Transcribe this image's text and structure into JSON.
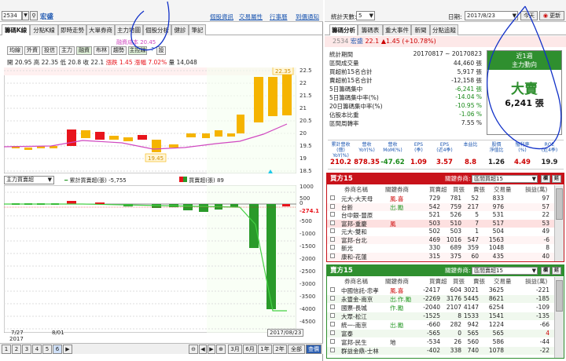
{
  "left_top": {
    "code": "2534",
    "name": "宏盛",
    "links": [
      "個股資訊",
      "交易屬性",
      "行事曆",
      "到價通知"
    ]
  },
  "left_tabs": [
    "籌碼K線",
    "分點K線",
    "即時走勢",
    "大單券商",
    "主力地圖",
    "個股分析",
    "健診",
    "筆記"
  ],
  "chart_note": "融資成本 20.45",
  "chart_buttons": [
    "均線",
    "外資",
    "投信",
    "主力",
    "融資",
    "布林",
    "趨勢",
    "主控線",
    "?",
    "設"
  ],
  "quote": {
    "open_label": "開",
    "open": "20.95",
    "high_label": "高",
    "high": "22.35",
    "low_label": "低",
    "low": "20.8",
    "close_label": "收",
    "close": "22.1",
    "chg_label": "漲跌",
    "chg": "1.45",
    "pct_label": "漲幅",
    "pct": "7.02%",
    "vol_label": "量",
    "vol": "14,048"
  },
  "k_axis": [
    "22.5",
    "22",
    "21.5",
    "21",
    "20.5",
    "20",
    "19.5",
    "19",
    "18.5"
  ],
  "price_tags": {
    "high": "22.35",
    "low": "19.45"
  },
  "lower_select": "主力買賣超",
  "lower_legend": {
    "cum_label": "累計買賣超(張)",
    "cum": "-5,755",
    "daily_label": "買賣超(張)",
    "daily": "89"
  },
  "lower_axis": [
    "1000",
    "500",
    "0",
    "-500",
    "-1000",
    "-1500",
    "-2000",
    "-2500",
    "-3000",
    "-3500",
    "-4000",
    "-4500"
  ],
  "lower_tag": "-274.1",
  "dates": {
    "d1": "7/27",
    "year": "2017",
    "d2": "8/01",
    "d3": "2017/08/23"
  },
  "pages": [
    "1",
    "2",
    "3",
    "4",
    "5",
    "6"
  ],
  "periods": [
    "3月",
    "6月",
    "1年",
    "2年",
    "全部"
  ],
  "query_btn": "查價",
  "right_top": {
    "days_label": "統計天數:",
    "days": "5",
    "date_label": "日期:",
    "date": "2017/8/23",
    "today": "今天",
    "refresh": "更新"
  },
  "right_tabs": [
    "籌碼分析",
    "籌碼表",
    "重大事件",
    "新聞",
    "分點追蹤"
  ],
  "stock_line": {
    "code": "2534",
    "name": "宏盛",
    "price": "22.1",
    "chg": "▲1.45",
    "pct": "(+10.78%)"
  },
  "stats": [
    {
      "label": "統計期間",
      "value": "20170817 ~ 20170823",
      "color": "#222"
    },
    {
      "label": "區間成交量",
      "value": "44,460 張",
      "color": "#222"
    },
    {
      "label": "買超前15名合計",
      "value": "5,917 張",
      "color": "#222"
    },
    {
      "label": "賣超前15名合計",
      "value": "-12,158 張",
      "color": "#222"
    },
    {
      "label": "5日籌碼集中",
      "value": "-6,241 張",
      "color": "#1a8a1a"
    },
    {
      "label": "5日籌碼集中率(%)",
      "value": "-14.04 %",
      "color": "#1a8a1a"
    },
    {
      "label": "20日籌碼集中率(%)",
      "value": "-10.95 %",
      "color": "#1a8a1a"
    },
    {
      "label": "佔股本比重",
      "value": "-1.06 %",
      "color": "#1a8a1a"
    },
    {
      "label": "區間周轉率",
      "value": "7.55 %",
      "color": "#222"
    }
  ],
  "signal": {
    "period": "近1週",
    "title": "主力動向",
    "verdict": "大賣",
    "amount": "6,241 張"
  },
  "metrics": [
    {
      "label": "累計營收(億)",
      "sub": "YoY(%)",
      "value": "210.2",
      "color": "#c00"
    },
    {
      "label": "營收",
      "sub": "YoY(%)",
      "value": "878.35",
      "color": "#c00"
    },
    {
      "label": "營收",
      "sub": "MoM(%)",
      "value": "-47.62",
      "color": "#1a8a1a"
    },
    {
      "label": "EPS",
      "sub": "(季)",
      "value": "1.09",
      "color": "#c00"
    },
    {
      "label": "EPS",
      "sub": "(近4季)",
      "value": "3.57",
      "color": "#c00"
    },
    {
      "label": "本益比",
      "sub": "",
      "value": "8.8",
      "color": "#c00"
    },
    {
      "label": "股價",
      "sub": "淨值比",
      "value": "1.26",
      "color": "#222"
    },
    {
      "label": "殖利率",
      "sub": "(%)",
      "value": "4.49",
      "color": "#c00"
    },
    {
      "label": "ROE",
      "sub": "(近4季)",
      "value": "19.9",
      "color": "#222"
    }
  ],
  "buy": {
    "title": "買方15",
    "filter_label": "關鍵券商:",
    "filter": "區間買超15",
    "cols": [
      "券商名稱",
      "關鍵券商",
      "買賣超",
      "買張",
      "賣張",
      "交易量",
      "損益(萬)"
    ],
    "rows": [
      [
        "元大-大天母",
        "風.喜",
        "729",
        "781",
        "52",
        "833",
        "97"
      ],
      [
        "台新",
        "出.勵",
        "542",
        "759",
        "217",
        "976",
        "57"
      ],
      [
        "台中銀-豐原",
        "",
        "521",
        "526",
        "5",
        "531",
        "22"
      ],
      [
        "富邦-重慶",
        "風",
        "503",
        "510",
        "7",
        "517",
        "53"
      ],
      [
        "元大-雙和",
        "",
        "502",
        "503",
        "1",
        "504",
        "49"
      ],
      [
        "富邦-台北",
        "",
        "469",
        "1016",
        "547",
        "1563",
        "-6"
      ],
      [
        "新光",
        "",
        "330",
        "689",
        "359",
        "1048",
        "8"
      ],
      [
        "康和-花蓮",
        "",
        "315",
        "375",
        "60",
        "435",
        "40"
      ]
    ]
  },
  "sell": {
    "title": "賣方15",
    "filter_label": "關鍵券商:",
    "filter": "區間賣超15",
    "cols": [
      "券商名稱",
      "關鍵券商",
      "買賣超",
      "買張",
      "賣張",
      "交易量",
      "損益(萬)"
    ],
    "rows": [
      [
        "中國信託-忠孝",
        "風.喜",
        "-2417",
        "604",
        "3021",
        "3625",
        "-221"
      ],
      [
        "永豐金-南京",
        "出.作.勵",
        "-2269",
        "3176",
        "5445",
        "8621",
        "-185"
      ],
      [
        "國票-長城",
        "作.勵",
        "-2040",
        "2107",
        "4147",
        "6254",
        "-109"
      ],
      [
        "大眾-松江",
        "",
        "-1525",
        "8",
        "1533",
        "1541",
        "-135"
      ],
      [
        "統一-南京",
        "出.勵",
        "-660",
        "282",
        "942",
        "1224",
        "-66"
      ],
      [
        "富泰",
        "",
        "-565",
        "0",
        "565",
        "565",
        "4"
      ],
      [
        "富邦-民生",
        "地",
        "-534",
        "26",
        "560",
        "586",
        "-44"
      ],
      [
        "群益金鼎-士林",
        "",
        "-402",
        "338",
        "740",
        "1078",
        "-22"
      ]
    ]
  },
  "colors": {
    "up": "#e8141c",
    "down": "#2a9a2a",
    "gold": "#f5b400",
    "accent_red": "#c8121a",
    "accent_green": "#2f8f2f",
    "ink": "#1030c8"
  }
}
